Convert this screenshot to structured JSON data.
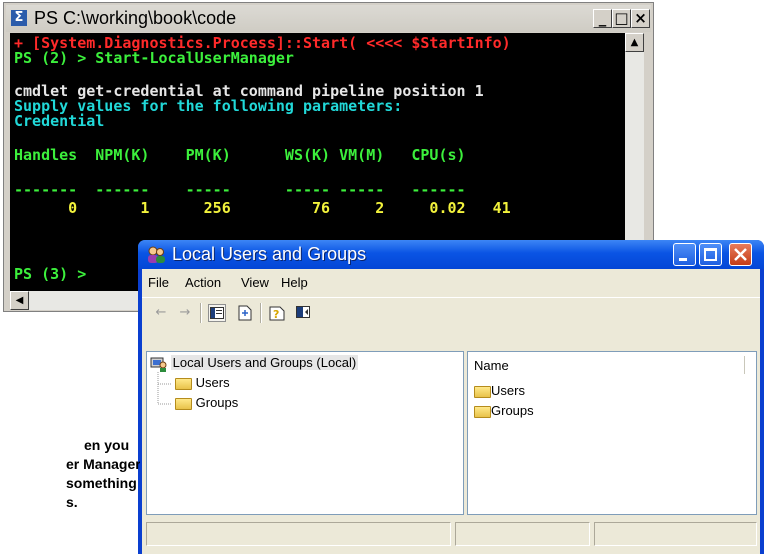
{
  "ps": {
    "title": "PS  C:\\working\\book\\code",
    "icon": "powershell-icon",
    "controls": {
      "minimize": "_",
      "maximize": "□",
      "close": "×"
    },
    "lines": [
      {
        "text": "+ [System.Diagnostics.Process]::Start( <<<< $StartInfo)",
        "color": "#ff2a2a"
      },
      {
        "text": "PS (2) > Start-LocalUserManager",
        "color": "#3cf03c"
      },
      {
        "text": "",
        "color": "#e6e6e6"
      },
      {
        "text": "cmdlet get-credential at command pipeline position 1",
        "color": "#e6e6e6"
      },
      {
        "text": "Supply values for the following parameters:",
        "color": "#21d8d8"
      },
      {
        "text": "Credential",
        "color": "#21d8d8"
      },
      {
        "text": "",
        "color": "#e6e6e6"
      },
      {
        "text": "Handles  NPM(K)    PM(K)      WS(K) VM(M)   CPU(s)",
        "color": "#3cf03c"
      },
      {
        "text": "",
        "color": "#e6e6e6"
      },
      {
        "text": "-------  ------    -----      ----- -----   ------",
        "color": "#3cf03c"
      },
      {
        "text": "      0       1      256         76     2     0.02   41",
        "color": "#f2f23c"
      },
      {
        "text": "",
        "color": "#e6e6e6"
      },
      {
        "text": "",
        "color": "#e6e6e6"
      },
      {
        "text": "PS (3) >",
        "color": "#3cf03c"
      }
    ]
  },
  "mmc": {
    "title": "Local Users and Groups",
    "menu": [
      "File",
      "Action",
      "View",
      "Help"
    ],
    "toolbar_icons": [
      "back-arrow-icon",
      "forward-arrow-icon",
      "show-hide-tree-icon",
      "export-list-icon",
      "help-icon",
      "properties-icon"
    ],
    "tree": {
      "root": "Local Users and Groups (Local)",
      "children": [
        "Users",
        "Groups"
      ]
    },
    "list": {
      "column": "Name",
      "items": [
        "Users",
        "Groups"
      ]
    }
  },
  "caption": {
    "lines": [
      "en you",
      "er Manager",
      "something",
      "s."
    ]
  }
}
